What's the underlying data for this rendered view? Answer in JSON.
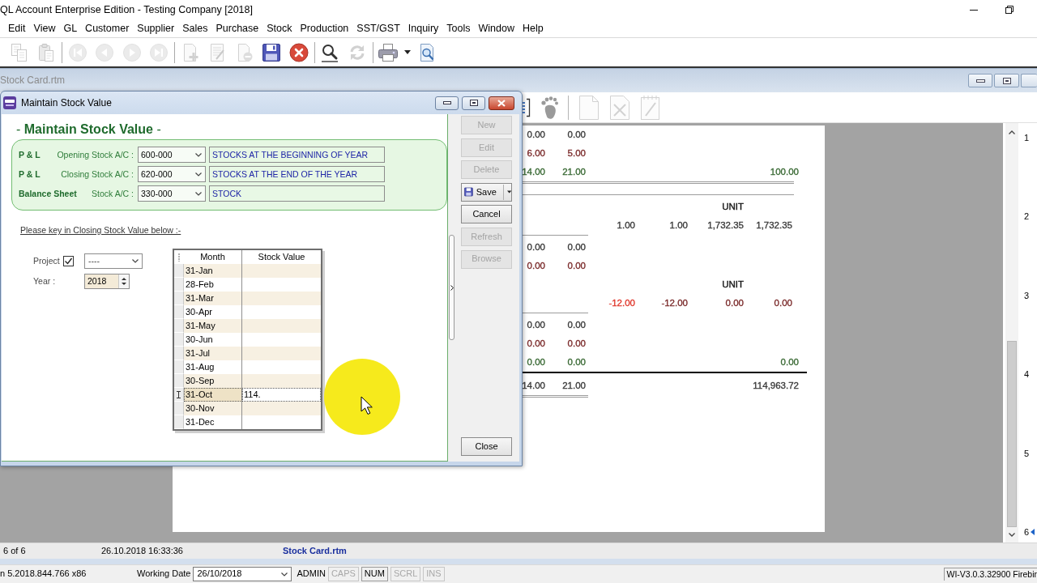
{
  "window": {
    "title": "QL Account Enterprise Edition - Testing Company [2018]"
  },
  "menu": [
    "Edit",
    "View",
    "GL",
    "Customer",
    "Supplier",
    "Sales",
    "Purchase",
    "Stock",
    "Production",
    "SST/GST",
    "Inquiry",
    "Tools",
    "Window",
    "Help"
  ],
  "toolbar": [
    {
      "kind": "copy",
      "disabled": true
    },
    {
      "kind": "paste",
      "disabled": true
    },
    {
      "kind": "separator"
    },
    {
      "kind": "first",
      "disabled": true
    },
    {
      "kind": "previous",
      "disabled": true
    },
    {
      "kind": "next",
      "disabled": true
    },
    {
      "kind": "last",
      "disabled": true
    },
    {
      "kind": "separator"
    },
    {
      "kind": "new",
      "disabled": true
    },
    {
      "kind": "edit",
      "disabled": true
    },
    {
      "kind": "delete",
      "disabled": true
    },
    {
      "kind": "save",
      "disabled": false
    },
    {
      "kind": "cancel",
      "disabled": false
    },
    {
      "kind": "separator"
    },
    {
      "kind": "find",
      "disabled": false
    },
    {
      "kind": "refresh",
      "disabled": true
    },
    {
      "kind": "separator"
    },
    {
      "kind": "print",
      "disabled": false
    },
    {
      "kind": "dropdown",
      "disabled": false
    },
    {
      "kind": "preview",
      "disabled": false
    }
  ],
  "document": {
    "title": "Stock Card.rtm",
    "toolbar": [
      {
        "kind": "report",
        "disabled": false
      },
      {
        "kind": "footprint",
        "disabled": false
      },
      {
        "kind": "separator"
      },
      {
        "kind": "blank-page",
        "disabled": true
      },
      {
        "kind": "page-cross",
        "disabled": true
      },
      {
        "kind": "notepad",
        "disabled": true
      }
    ],
    "report_rows": [
      {
        "kind": "figures",
        "cells": {
          "column_1": {
            "text": "0.00",
            "color": "#3a3a3a"
          },
          "column_2": {
            "text": "0.00",
            "color": "#3a3a3a"
          }
        }
      },
      {
        "kind": "figures",
        "cells": {
          "column_1": {
            "text": "6.00",
            "color": "#7b2b2b"
          },
          "column_2": {
            "text": "5.00",
            "color": "#7b2b2b"
          }
        }
      },
      {
        "kind": "figures",
        "cells": {
          "column_1": {
            "text": "14.00",
            "color": "#3a6a35"
          },
          "column_2": {
            "text": "21.00",
            "color": "#3a6a35"
          },
          "column_7": {
            "text": "100.00",
            "color": "#3a6a35"
          }
        }
      },
      {
        "kind": "double-divider"
      },
      {
        "kind": "divider"
      },
      {
        "kind": "figures",
        "cells": {
          "column_5": {
            "text": "UNIT",
            "color": "#111111"
          }
        }
      },
      {
        "kind": "figures",
        "cells": {
          "column_3": {
            "text": "1.00",
            "color": "#3a3a3a"
          },
          "column_4": {
            "text": "1.00",
            "color": "#3a3a3a"
          },
          "column_5": {
            "text": "1,732.35",
            "color": "#3a3a3a"
          },
          "column_6": {
            "text": "1,732.35",
            "color": "#3a3a3a"
          }
        }
      },
      {
        "kind": "subtotal-line"
      },
      {
        "kind": "figures",
        "cells": {
          "column_1": {
            "text": "0.00",
            "color": "#3a3a3a"
          },
          "column_2": {
            "text": "0.00",
            "color": "#3a3a3a"
          }
        }
      },
      {
        "kind": "figures",
        "cells": {
          "column_1": {
            "text": "0.00",
            "color": "#7b2b2b"
          },
          "column_2": {
            "text": "0.00",
            "color": "#7b2b2b"
          }
        }
      },
      {
        "kind": "figures",
        "cells": {
          "column_5": {
            "text": "UNIT",
            "color": "#111111"
          }
        }
      },
      {
        "kind": "figures",
        "cells": {
          "column_3": {
            "text": "-12.00",
            "color": "#e0392e"
          },
          "column_4": {
            "text": "-12.00",
            "color": "#7b2b2b"
          },
          "column_5": {
            "text": "0.00",
            "color": "#7b2b2b"
          },
          "column_6": {
            "text": "0.00",
            "color": "#7b2b2b"
          }
        }
      },
      {
        "kind": "subtotal-line"
      },
      {
        "kind": "figures",
        "cells": {
          "column_1": {
            "text": "0.00",
            "color": "#3a3a3a"
          },
          "column_2": {
            "text": "0.00",
            "color": "#3a3a3a"
          }
        }
      },
      {
        "kind": "figures",
        "cells": {
          "column_1": {
            "text": "0.00",
            "color": "#7b2b2b"
          },
          "column_2": {
            "text": "0.00",
            "color": "#7b2b2b"
          }
        }
      },
      {
        "kind": "figures",
        "cells": {
          "column_1": {
            "text": "0.00",
            "color": "#3a6a35"
          },
          "column_2": {
            "text": "0.00",
            "color": "#3a6a35"
          },
          "column_7": {
            "text": "0.00",
            "color": "#3a6a35"
          }
        }
      },
      {
        "kind": "total-line"
      },
      {
        "kind": "figures",
        "cells": {
          "column_1": {
            "text": "14.00",
            "color": "#3a3a3a"
          },
          "column_2": {
            "text": "21.00",
            "color": "#3a3a3a"
          },
          "column_7": {
            "text": "114,963.72",
            "color": "#3a3a3a"
          }
        }
      },
      {
        "kind": "double-underline"
      }
    ],
    "pages": [
      {
        "label": "1",
        "selected": false
      },
      {
        "label": "2",
        "selected": false
      },
      {
        "label": "3",
        "selected": false
      },
      {
        "label": "4",
        "selected": false
      },
      {
        "label": "5",
        "selected": false
      },
      {
        "label": "6",
        "selected": true
      }
    ],
    "status": {
      "position": "6 of 6",
      "timestamp": "26.10.2018 16:33:36",
      "file": "Stock Card.rtm"
    }
  },
  "dialog": {
    "title": "Maintain Stock Value",
    "heading": "- **Maintain Stock Value** -",
    "accounts": [
      {
        "group": "P & L",
        "label": "Opening Stock A/C :",
        "code": "600-000",
        "description": "STOCKS AT THE BEGINNING OF YEAR"
      },
      {
        "group": "P & L",
        "label": "Closing Stock A/C :",
        "code": "620-000",
        "description": "STOCKS AT THE END OF THE YEAR"
      },
      {
        "group": "Balance Sheet",
        "label": "Stock A/C :",
        "code": "330-000",
        "description": "STOCK"
      }
    ],
    "instruction": "Please key in Closing Stock Value below :-",
    "project": {
      "label": "Project",
      "checked": true,
      "value": "----"
    },
    "year": {
      "label": "Year :",
      "value": "2018"
    },
    "grid": {
      "columns": [
        "Month",
        "Stock Value"
      ],
      "rows": [
        {
          "month": "31-Jan",
          "selected": false
        },
        {
          "month": "28-Feb",
          "selected": false
        },
        {
          "month": "31-Mar",
          "selected": false
        },
        {
          "month": "30-Apr",
          "selected": false
        },
        {
          "month": "31-May",
          "selected": false
        },
        {
          "month": "30-Jun",
          "selected": false
        },
        {
          "month": "31-Jul",
          "selected": false
        },
        {
          "month": "31-Aug",
          "selected": false
        },
        {
          "month": "30-Sep",
          "selected": false
        },
        {
          "month": "31-Oct",
          "stock_value": "114.",
          "selected": true
        },
        {
          "month": "30-Nov",
          "selected": false
        },
        {
          "month": "31-Dec",
          "selected": false
        }
      ]
    },
    "buttons": [
      {
        "label": "New",
        "kind": "plain",
        "disabled": true
      },
      {
        "label": "Edit",
        "kind": "plain",
        "disabled": true
      },
      {
        "label": "Delete",
        "kind": "plain",
        "disabled": true
      },
      {
        "label": "Save",
        "kind": "split",
        "disabled": false
      },
      {
        "label": "Cancel",
        "kind": "plain",
        "disabled": false
      },
      {
        "label": "Refresh",
        "kind": "plain",
        "disabled": true
      },
      {
        "label": "Browse",
        "kind": "plain",
        "disabled": true
      }
    ],
    "close_button": "Close"
  },
  "status_bar": {
    "version": "n 5.2018.844.766 x86",
    "working_date_label": "Working Date",
    "working_date": "26/10/2018",
    "user": "ADMIN",
    "indicators": [
      {
        "label": "CAPS",
        "on": false
      },
      {
        "label": "NUM",
        "on": true
      },
      {
        "label": "SCRL",
        "on": false
      },
      {
        "label": "INS",
        "on": false
      }
    ],
    "server": "WI-V3.0.3.32900 Firebir"
  }
}
